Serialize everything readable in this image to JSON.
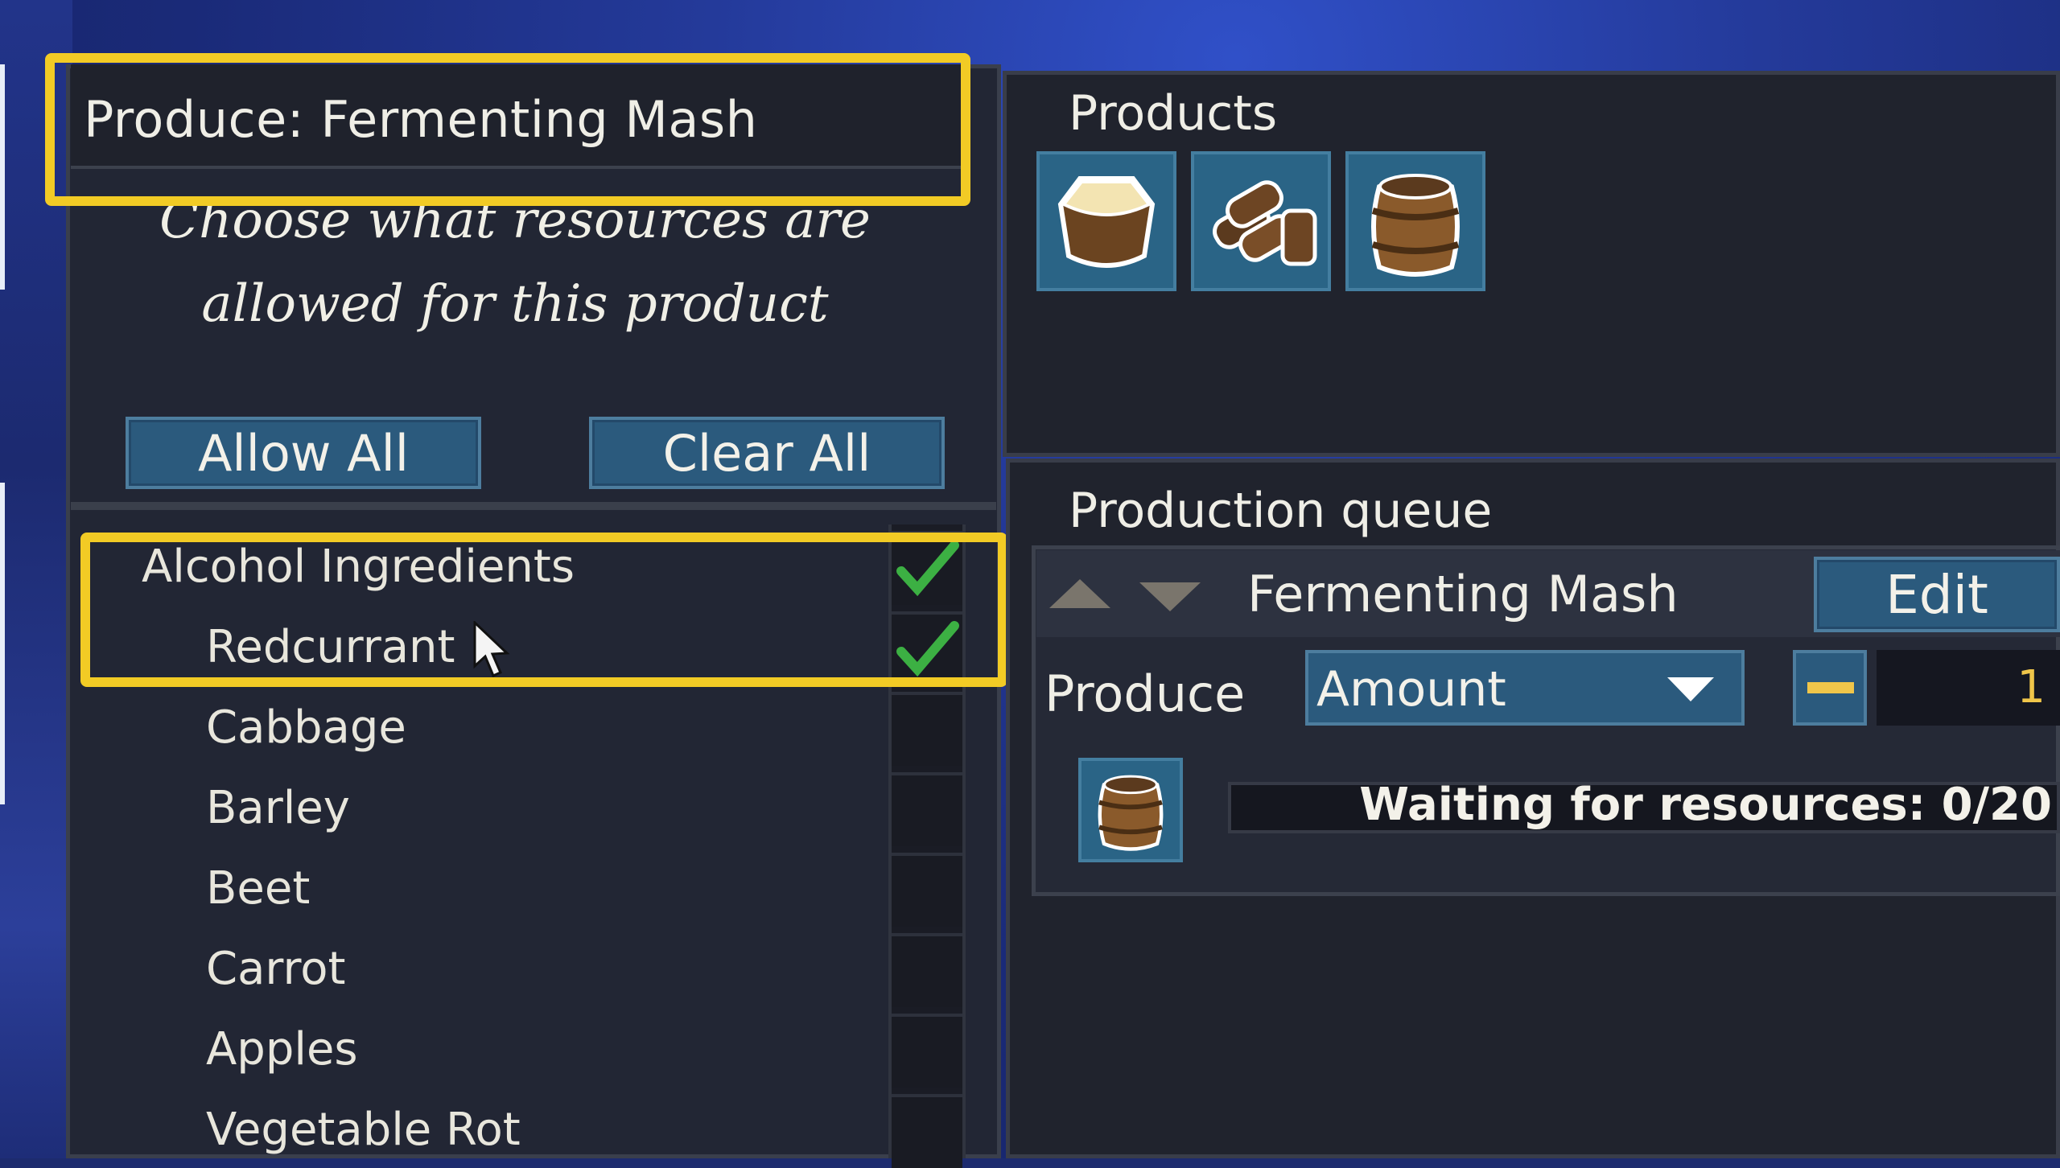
{
  "colors": {
    "highlight": "#f2cb25",
    "button_fill": "#2b5a7d",
    "check": "#3cb043",
    "panel": "#222634"
  },
  "left_panel": {
    "title": "Produce: Fermenting Mash",
    "description_line1": "Choose what resources are",
    "description_line2": "allowed for this product",
    "allow_all_label": "Allow All",
    "clear_all_label": "Clear All",
    "category": {
      "label": "Alcohol Ingredients",
      "checked": true
    },
    "items": [
      {
        "label": "Redcurrant",
        "checked": true
      },
      {
        "label": "Cabbage",
        "checked": false
      },
      {
        "label": "Barley",
        "checked": false
      },
      {
        "label": "Beet",
        "checked": false
      },
      {
        "label": "Carrot",
        "checked": false
      },
      {
        "label": "Apples",
        "checked": false
      },
      {
        "label": "Vegetable Rot",
        "checked": false
      }
    ]
  },
  "products": {
    "label": "Products",
    "icons": [
      "mash-bowl-icon",
      "firewood-stack-icon",
      "barrel-icon"
    ]
  },
  "queue": {
    "label": "Production queue",
    "item_name": "Fermenting Mash",
    "edit_label": "Edit",
    "produce_label": "Produce",
    "mode_value": "Amount",
    "amount_value": "1",
    "status_text": "Waiting for resources: 0/20",
    "status_icon": "barrel-icon"
  }
}
